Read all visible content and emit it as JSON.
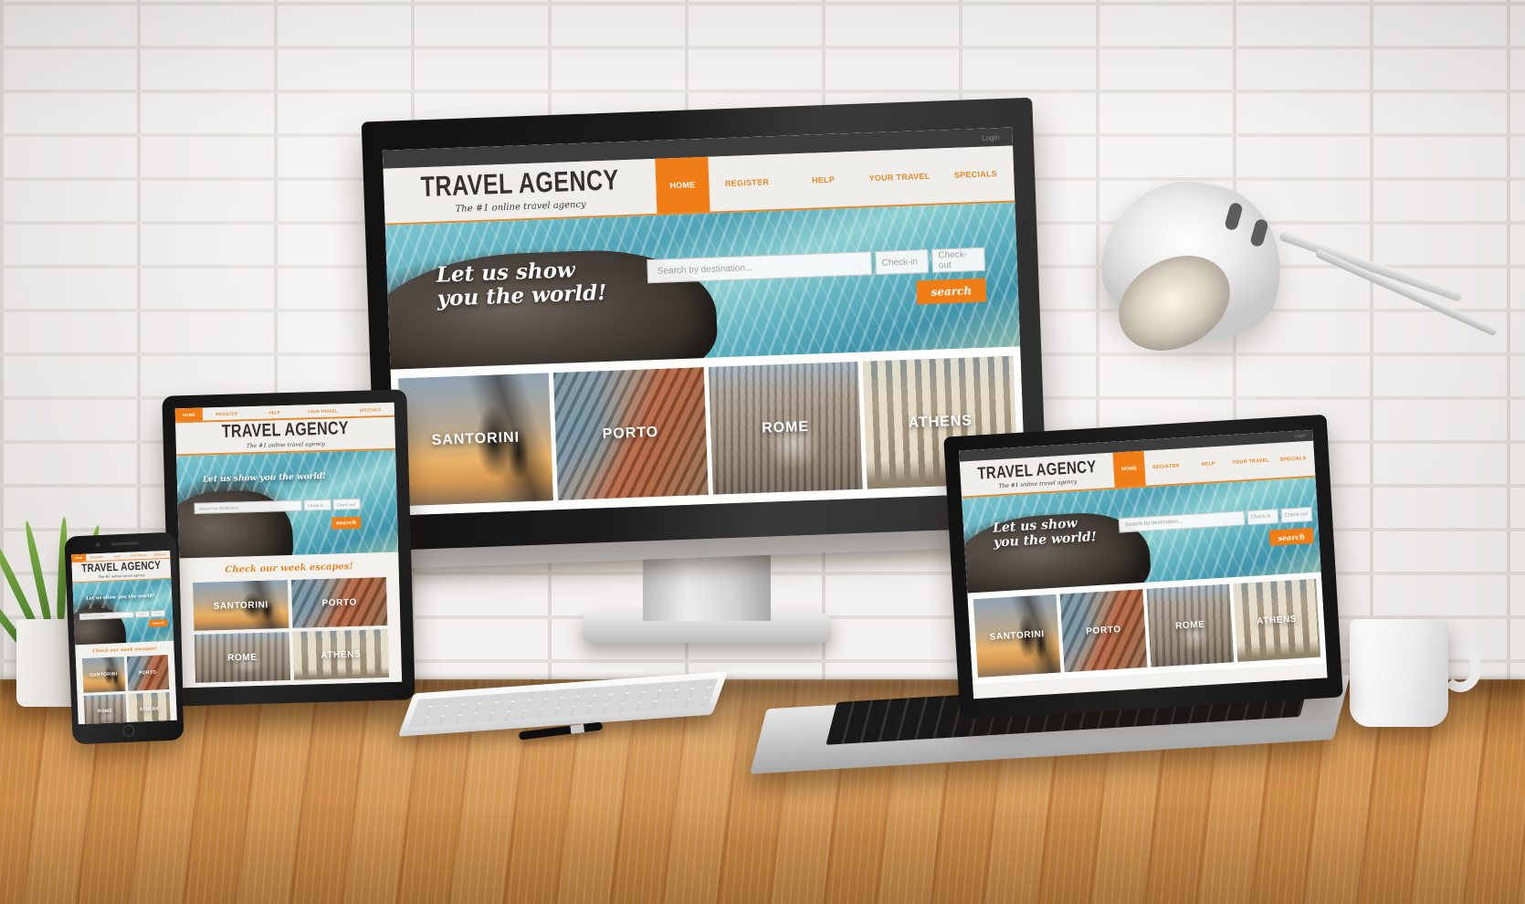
{
  "scene": {
    "description": "Responsive web design mockup on a wooden desk with white brick wall",
    "devices": [
      "desktop-imac",
      "tablet",
      "smartphone",
      "laptop"
    ],
    "props": [
      "desk-lamp",
      "keyboard",
      "pen",
      "potted-plant",
      "coffee-mug"
    ]
  },
  "colors": {
    "accent_orange": "#f07d16",
    "accent_orange_text": "#e5892b",
    "page_bg": "#f3f1ed",
    "header_bg": "#f0eeea",
    "dark_text": "#34312e",
    "wood": "#c4873f",
    "wall": "#f2f0ee"
  },
  "site": {
    "brand": {
      "title": "TRAVEL AGENCY",
      "tagline": "The #1 online travel agency"
    },
    "login_label": "Login",
    "nav": [
      {
        "label": "HOME",
        "active": true
      },
      {
        "label": "REGISTER",
        "active": false
      },
      {
        "label": "HELP",
        "active": false
      },
      {
        "label": "YOUR TRAVEL",
        "active": false
      },
      {
        "label": "SPECIALS",
        "active": false
      }
    ],
    "hero": {
      "headline_line1": "Let us show",
      "headline_line2": "you the world!",
      "headline_full": "Let us show you the world!"
    },
    "search": {
      "destination_placeholder": "Search by destination...",
      "checkin_label": "Check-in",
      "checkout_label": "Check-out",
      "submit_label": "search"
    },
    "escapes_heading": "Check our week escapes!",
    "destinations": [
      {
        "name": "SANTORINI",
        "style": "ph-santorini"
      },
      {
        "name": "PORTO",
        "style": "ph-porto"
      },
      {
        "name": "ROME",
        "style": "ph-rome"
      },
      {
        "name": "ATHENS",
        "style": "ph-athens"
      }
    ]
  }
}
